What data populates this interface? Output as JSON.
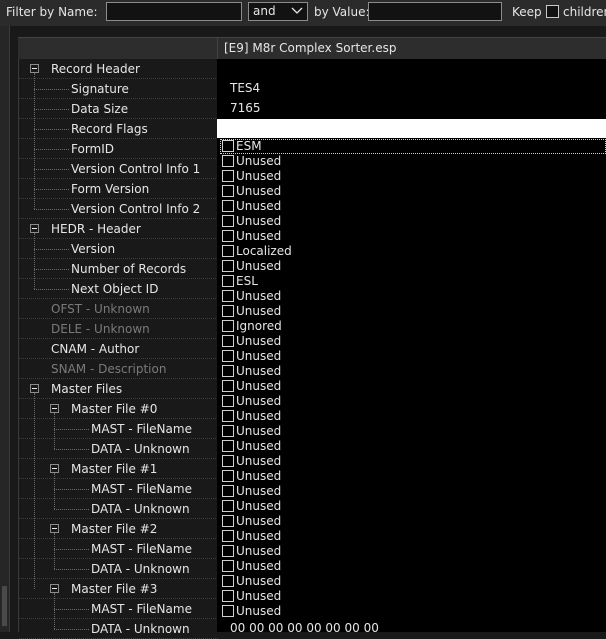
{
  "filter": {
    "name_label": "Filter by Name:",
    "name_value": "",
    "operator": "and",
    "value_label": "by Value:",
    "value_value": "",
    "keep_label": "Keep",
    "children_label": "children"
  },
  "header": {
    "title": "[E9] M8r Complex Sorter.esp"
  },
  "tree": [
    {
      "label": "Record Header",
      "level": 0,
      "toggle": true
    },
    {
      "label": "Signature",
      "level": 1
    },
    {
      "label": "Data Size",
      "level": 1
    },
    {
      "label": "Record Flags",
      "level": 1
    },
    {
      "label": "FormID",
      "level": 1
    },
    {
      "label": "Version Control Info 1",
      "level": 1
    },
    {
      "label": "Form Version",
      "level": 1
    },
    {
      "label": "Version Control Info 2",
      "level": 1
    },
    {
      "label": "HEDR - Header",
      "level": 0,
      "toggle": true
    },
    {
      "label": "Version",
      "level": 1
    },
    {
      "label": "Number of Records",
      "level": 1
    },
    {
      "label": "Next Object ID",
      "level": 1
    },
    {
      "label": "OFST - Unknown",
      "level": 0,
      "dim": true
    },
    {
      "label": "DELE - Unknown",
      "level": 0,
      "dim": true
    },
    {
      "label": "CNAM - Author",
      "level": 0
    },
    {
      "label": "SNAM - Description",
      "level": 0,
      "dim": true
    },
    {
      "label": "Master Files",
      "level": 0,
      "toggle": true
    },
    {
      "label": "Master File #0",
      "level": 1,
      "toggle": true
    },
    {
      "label": "MAST - FileName",
      "level": 2
    },
    {
      "label": "DATA - Unknown",
      "level": 2
    },
    {
      "label": "Master File #1",
      "level": 1,
      "toggle": true
    },
    {
      "label": "MAST - FileName",
      "level": 2
    },
    {
      "label": "DATA - Unknown",
      "level": 2
    },
    {
      "label": "Master File #2",
      "level": 1,
      "toggle": true
    },
    {
      "label": "MAST - FileName",
      "level": 2
    },
    {
      "label": "DATA - Unknown",
      "level": 2
    },
    {
      "label": "Master File #3",
      "level": 1,
      "toggle": true
    },
    {
      "label": "MAST - FileName",
      "level": 2
    },
    {
      "label": "DATA - Unknown",
      "level": 2
    }
  ],
  "values": {
    "signature": "TES4",
    "data_size": "7165",
    "bottom": "00 00 00 00 00 00 00 00"
  },
  "flags": [
    "ESM",
    "Unused",
    "Unused",
    "Unused",
    "Unused",
    "Unused",
    "Unused",
    "Localized",
    "Unused",
    "ESL",
    "Unused",
    "Unused",
    "Ignored",
    "Unused",
    "Unused",
    "Unused",
    "Unused",
    "Unused",
    "Unused",
    "Unused",
    "Unused",
    "Unused",
    "Unused",
    "Unused",
    "Unused",
    "Unused",
    "Unused",
    "Unused",
    "Unused",
    "Unused",
    "Unused",
    "Unused"
  ]
}
